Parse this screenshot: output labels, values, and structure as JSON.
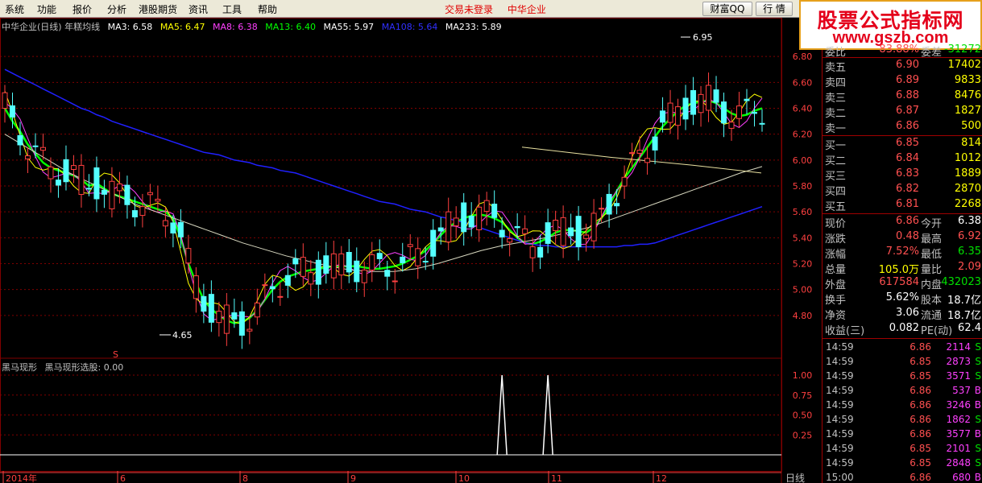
{
  "menu": {
    "items": [
      "系统",
      "功能",
      "报价",
      "分析",
      "港股期货",
      "资讯",
      "工具",
      "帮助"
    ],
    "status_login": "交易未登录",
    "status_stock": "中华企业",
    "btn_caifu": "财富QQ",
    "btn_hangqing": "行 情"
  },
  "logo": {
    "title": "股票公式指标网",
    "url": "www.gszb.com"
  },
  "legend": {
    "stock": "中华企业(日线) 年糕均线",
    "ma": [
      {
        "label": "MA3: 6.58",
        "color": "#ffffff"
      },
      {
        "label": "MA5: 6.47",
        "color": "#ffff00"
      },
      {
        "label": "MA8: 6.38",
        "color": "#ff40ff"
      },
      {
        "label": "MA13: 6.40",
        "color": "#00ff00"
      },
      {
        "label": "MA55: 5.97",
        "color": "#ffffff"
      },
      {
        "label": "MA108: 5.64",
        "color": "#2020ff"
      },
      {
        "label": "MA233: 5.89",
        "color": "#ffffff"
      }
    ]
  },
  "indicator": {
    "name": "黑马现形",
    "value": "黑马现形选股: 0.00"
  },
  "price_axis": [
    "6.80",
    "6.60",
    "6.40",
    "6.20",
    "6.00",
    "5.80",
    "5.60",
    "5.40",
    "5.20",
    "5.00",
    "4.80"
  ],
  "ind_axis": [
    "1.00",
    "0.75",
    "0.50",
    "0.25"
  ],
  "annotations": {
    "high": "6.95",
    "low": "4.65",
    "s_marker": "S"
  },
  "date_axis": [
    "2014年",
    "6",
    "8",
    "9",
    "10",
    "11",
    "12"
  ],
  "dayline_tab": "日线",
  "colors": {
    "up": "#ff4040",
    "down": "#54ffff",
    "grid": "#800000",
    "ma13": "#00ff00",
    "ma108": "#2020ff",
    "ma8": "#ff40ff"
  },
  "quote": {
    "top_partial": {
      "label": "委比",
      "value": "83.88%",
      "label2": "委差",
      "value2": "-31272"
    },
    "asks": [
      {
        "label": "卖五",
        "price": "6.90",
        "vol": "17402"
      },
      {
        "label": "卖四",
        "price": "6.89",
        "vol": "9833"
      },
      {
        "label": "卖三",
        "price": "6.88",
        "vol": "8476"
      },
      {
        "label": "卖二",
        "price": "6.87",
        "vol": "1827"
      },
      {
        "label": "卖一",
        "price": "6.86",
        "vol": "500"
      }
    ],
    "bids": [
      {
        "label": "买一",
        "price": "6.85",
        "vol": "814"
      },
      {
        "label": "买二",
        "price": "6.84",
        "vol": "1012"
      },
      {
        "label": "买三",
        "price": "6.83",
        "vol": "1889"
      },
      {
        "label": "买四",
        "price": "6.82",
        "vol": "2870"
      },
      {
        "label": "买五",
        "price": "6.81",
        "vol": "2268"
      }
    ],
    "stats": [
      {
        "l1": "现价",
        "v1": "6.86",
        "c1": "red",
        "l2": "今开",
        "v2": "6.38",
        "c2": "white"
      },
      {
        "l1": "涨跌",
        "v1": "0.48",
        "c1": "red",
        "l2": "最高",
        "v2": "6.92",
        "c2": "red"
      },
      {
        "l1": "涨幅",
        "v1": "7.52%",
        "c1": "red",
        "l2": "最低",
        "v2": "6.35",
        "c2": "green"
      },
      {
        "l1": "总量",
        "v1": "105.0万",
        "c1": "yellow",
        "l2": "量比",
        "v2": "2.09",
        "c2": "red"
      },
      {
        "l1": "外盘",
        "v1": "617584",
        "c1": "red",
        "l2": "内盘",
        "v2": "432023",
        "c2": "green"
      },
      {
        "l1": "换手",
        "v1": "5.62%",
        "c1": "white",
        "l2": "股本",
        "v2": "18.7亿",
        "c2": "white"
      },
      {
        "l1": "净资",
        "v1": "3.06",
        "c1": "white",
        "l2": "流通",
        "v2": "18.7亿",
        "c2": "white"
      },
      {
        "l1": "收益(三)",
        "v1": "0.082",
        "c1": "white",
        "l2": "PE(动)",
        "v2": "62.4",
        "c2": "white"
      }
    ],
    "ticks": [
      {
        "time": "14:59",
        "price": "6.86",
        "vol": "2114",
        "flag": "S"
      },
      {
        "time": "14:59",
        "price": "6.85",
        "vol": "2873",
        "flag": "S"
      },
      {
        "time": "14:59",
        "price": "6.85",
        "vol": "3571",
        "flag": "S"
      },
      {
        "time": "14:59",
        "price": "6.86",
        "vol": "537",
        "flag": "B"
      },
      {
        "time": "14:59",
        "price": "6.86",
        "vol": "3246",
        "flag": "B"
      },
      {
        "time": "14:59",
        "price": "6.86",
        "vol": "1862",
        "flag": "S"
      },
      {
        "time": "14:59",
        "price": "6.86",
        "vol": "3577",
        "flag": "B"
      },
      {
        "time": "14:59",
        "price": "6.85",
        "vol": "2101",
        "flag": "S"
      },
      {
        "time": "14:59",
        "price": "6.85",
        "vol": "2848",
        "flag": "S"
      },
      {
        "time": "15:00",
        "price": "6.86",
        "vol": "680",
        "flag": "B"
      }
    ]
  },
  "chart_data": {
    "type": "candlestick",
    "price_range": [
      4.6,
      7.0
    ],
    "ma_series": [
      {
        "name": "MA13",
        "color": "#00ff00",
        "values": [
          6.4,
          6.3,
          6.22,
          6.12,
          6.05,
          5.98,
          5.94,
          5.92,
          5.9,
          5.88,
          5.85,
          5.8,
          5.82,
          5.78,
          5.74,
          5.72,
          5.7,
          5.68,
          5.66,
          5.64,
          5.62,
          5.6,
          5.55,
          5.4,
          5.2,
          5.05,
          4.92,
          4.85,
          4.8,
          4.76,
          4.74,
          4.75,
          4.78,
          4.84,
          4.92,
          5.0,
          5.06,
          5.1,
          5.12,
          5.14,
          5.15,
          5.16,
          5.17,
          5.18,
          5.18,
          5.18,
          5.18,
          5.17,
          5.16,
          5.16,
          5.17,
          5.18,
          5.2,
          5.23,
          5.26,
          5.3,
          5.36,
          5.42,
          5.48,
          5.52,
          5.55,
          5.57,
          5.58,
          5.57,
          5.55,
          5.52,
          5.46,
          5.4,
          5.36,
          5.35,
          5.37,
          5.4,
          5.44,
          5.46,
          5.46,
          5.45,
          5.44,
          5.48,
          5.55,
          5.65,
          5.76,
          5.86,
          5.94,
          6.02,
          6.1,
          6.18,
          6.26,
          6.32,
          6.38,
          6.42,
          6.44,
          6.45,
          6.46,
          6.44,
          6.4,
          6.36,
          6.34,
          6.35,
          6.38,
          6.4
        ]
      },
      {
        "name": "MA108",
        "color": "#2020ff",
        "values": [
          6.7,
          6.67,
          6.64,
          6.61,
          6.58,
          6.55,
          6.52,
          6.49,
          6.46,
          6.43,
          6.4,
          6.38,
          6.35,
          6.33,
          6.3,
          6.28,
          6.26,
          6.24,
          6.22,
          6.2,
          6.18,
          6.16,
          6.14,
          6.12,
          6.1,
          6.08,
          6.06,
          6.05,
          6.04,
          6.02,
          6.0,
          5.99,
          5.98,
          5.96,
          5.95,
          5.94,
          5.92,
          5.91,
          5.9,
          5.88,
          5.86,
          5.84,
          5.82,
          5.8,
          5.78,
          5.76,
          5.74,
          5.72,
          5.7,
          5.68,
          5.67,
          5.66,
          5.64,
          5.62,
          5.61,
          5.6,
          5.58,
          5.56,
          5.55,
          5.53,
          5.52,
          5.5,
          5.48,
          5.46,
          5.44,
          5.42,
          5.4,
          5.38,
          5.36,
          5.35,
          5.34,
          5.34,
          5.33,
          5.33,
          5.33,
          5.33,
          5.33,
          5.33,
          5.33,
          5.33,
          5.33,
          5.34,
          5.34,
          5.35,
          5.35,
          5.36,
          5.38,
          5.4,
          5.42,
          5.44,
          5.46,
          5.48,
          5.5,
          5.52,
          5.54,
          5.56,
          5.58,
          5.6,
          5.62,
          5.64
        ]
      }
    ],
    "indicator_spikes": [
      {
        "x_index": 65,
        "value": 1.0
      },
      {
        "x_index": 71,
        "value": 1.0
      }
    ]
  }
}
